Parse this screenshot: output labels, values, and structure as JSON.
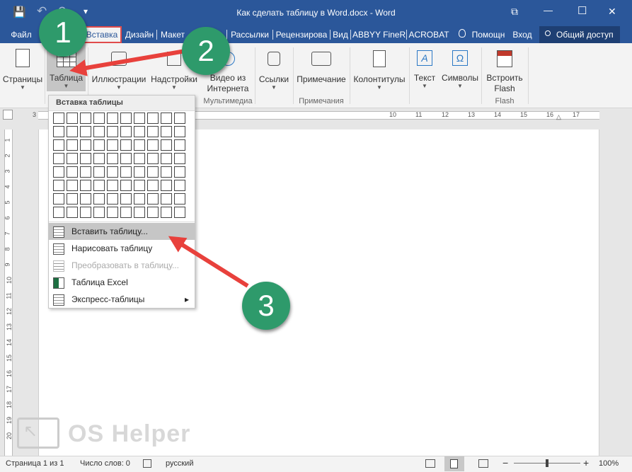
{
  "window": {
    "title": "Как сделать таблицу в Word.docx - Word",
    "controls": {
      "restore_ribbon": "⧉",
      "minimize": "—",
      "maximize": "☐",
      "close": "✕"
    },
    "qat": {
      "save": "💾",
      "undo": "↶",
      "redo": "↷",
      "customize": "▾"
    }
  },
  "tabs": [
    "Файл",
    "Вставка",
    "Дизайн",
    "Макет",
    "Рассылки",
    "Рецензирова",
    "Вид",
    "ABBYY FineR",
    "ACROBAT",
    "Помощн",
    "Вход",
    "Общий доступ"
  ],
  "ribbon": {
    "buttons": {
      "pages": "Страницы",
      "table": "Таблица",
      "illustrations": "Иллюстрации",
      "addins": "Надстройки",
      "video_line1": "Видео из",
      "video_line2": "Интернета",
      "links": "Ссылки",
      "comment": "Примечание",
      "header_footer": "Колонтитулы",
      "text": "Текст",
      "symbols": "Символы",
      "flash_line1": "Встроить",
      "flash_line2": "Flash"
    },
    "groups": {
      "media": "Мультимедиа",
      "comments": "Примечания",
      "flash": "Flash"
    }
  },
  "ruler": {
    "h_left": "3",
    "h_right": [
      "10",
      "11",
      "12",
      "13",
      "14",
      "15",
      "16",
      "17"
    ],
    "v_marks": [
      "1",
      "2",
      "3",
      "4",
      "5",
      "6",
      "7",
      "8",
      "9",
      "10",
      "11",
      "12",
      "13",
      "14",
      "15",
      "16",
      "17",
      "18",
      "19",
      "20"
    ]
  },
  "table_menu": {
    "header": "Вставка таблицы",
    "grid": {
      "cols": 10,
      "rows": 8
    },
    "items": [
      {
        "label": "Вставить таблицу...",
        "highlighted": true,
        "disabled": false,
        "icon": "insert-table-icon"
      },
      {
        "label": "Нарисовать таблицу",
        "highlighted": false,
        "disabled": false,
        "icon": "draw-table-icon"
      },
      {
        "label": "Преобразовать в таблицу...",
        "highlighted": false,
        "disabled": true,
        "icon": "convert-table-icon"
      },
      {
        "label": "Таблица Excel",
        "highlighted": false,
        "disabled": false,
        "icon": "excel-table-icon"
      },
      {
        "label": "Экспресс-таблицы",
        "highlighted": false,
        "disabled": false,
        "icon": "quick-tables-icon",
        "submenu": "▸"
      }
    ]
  },
  "annotations": [
    "1",
    "2",
    "3"
  ],
  "watermark": "OS Helper",
  "status": {
    "page": "Страница 1 из 1",
    "words": "Число слов: 0",
    "language": "русский",
    "zoom": "100%",
    "zoom_minus": "−",
    "zoom_plus": "+"
  },
  "colors": {
    "word_blue": "#2b579a",
    "annotation_green": "#2e9a6b",
    "arrow_red": "#e8413c",
    "tab_highlight": "#e04b4b"
  }
}
